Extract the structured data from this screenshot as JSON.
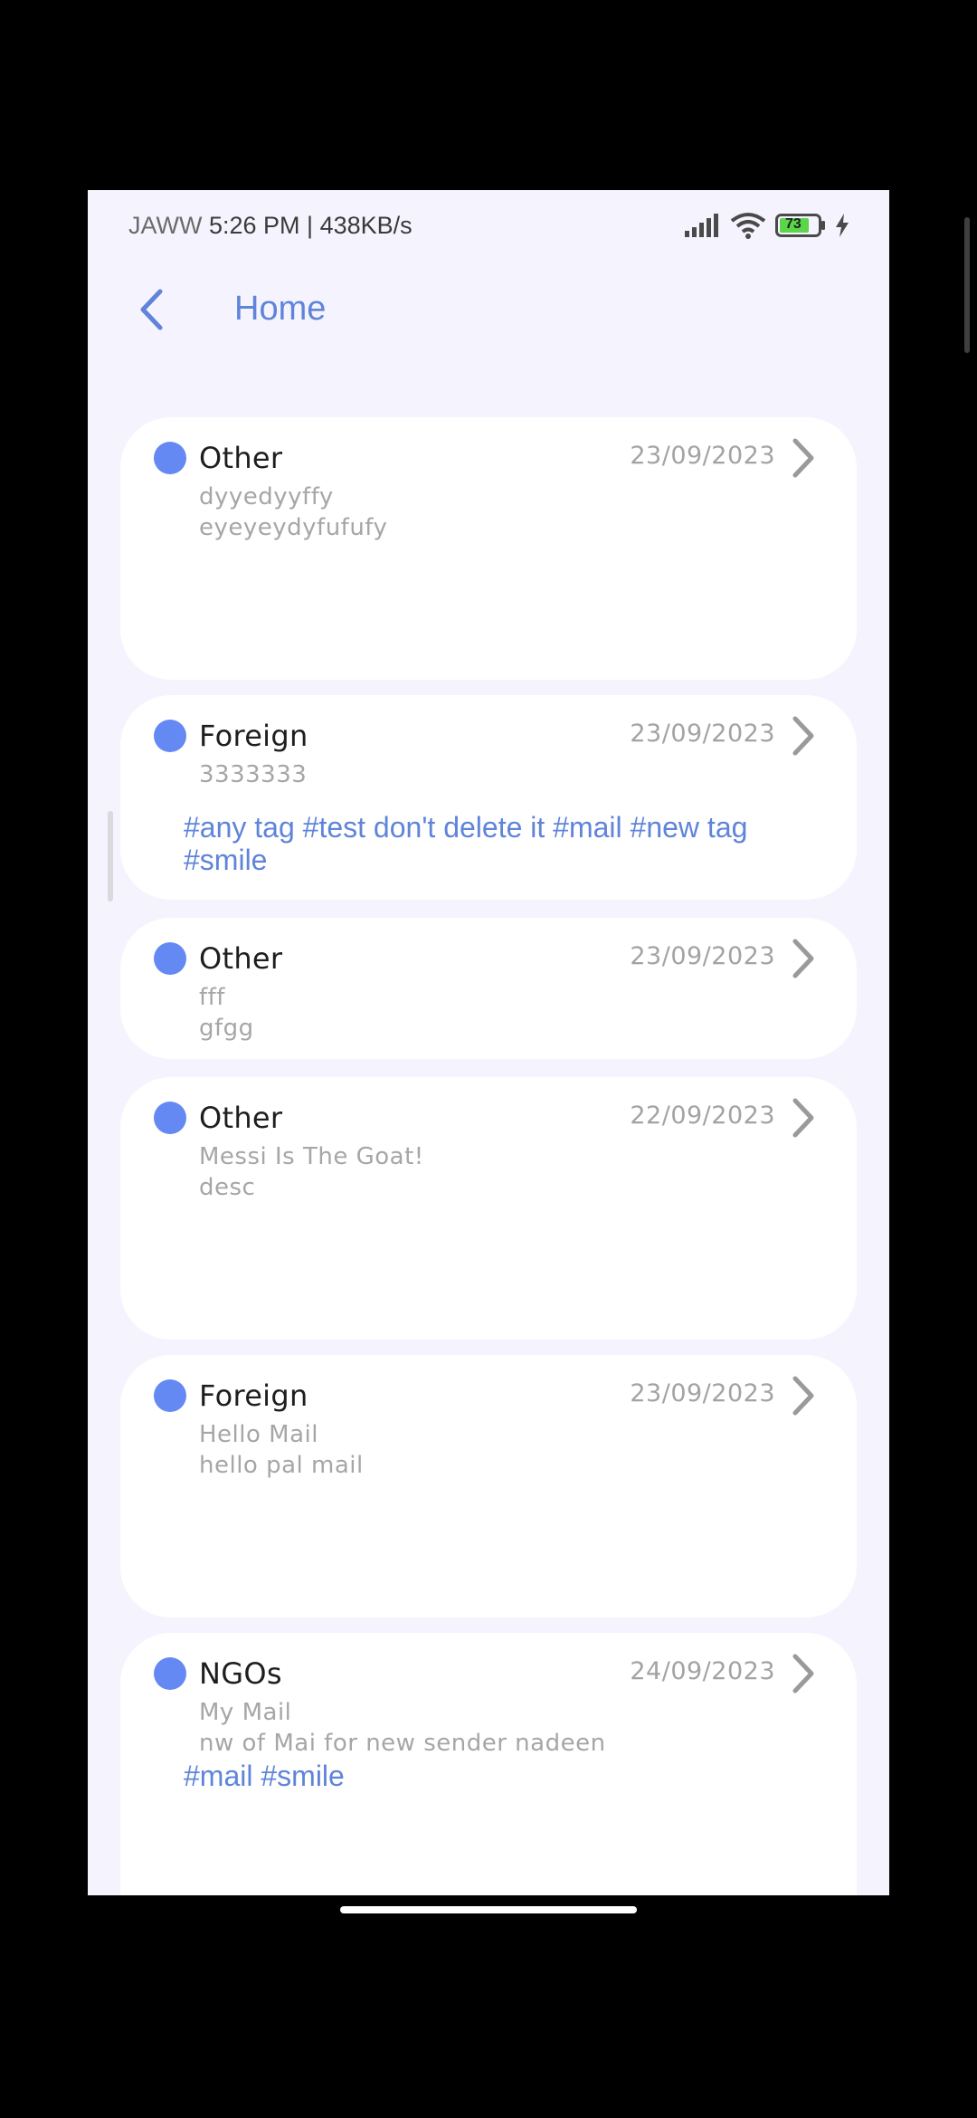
{
  "status_bar": {
    "carrier": "JAWW",
    "time_speed": "5:26 PM | 438KB/s",
    "battery": "73",
    "icons": [
      "signal-icon",
      "wifi-icon",
      "battery-icon",
      "charging-bolt-icon"
    ]
  },
  "app_bar": {
    "back_icon": "chevron-left-icon",
    "title": "Home"
  },
  "colors": {
    "background": "#f5f4fe",
    "accent": "#5f84d9",
    "dot": "#6489f2",
    "card": "#ffffff",
    "muted_text": "#a6a6a6"
  },
  "mails": [
    {
      "category": "Other",
      "date": "23/09/2023",
      "line1": "dyyedyyffy",
      "line2": "eyeyeydyfufufy",
      "tags": ""
    },
    {
      "category": "Foreign",
      "date": "23/09/2023",
      "line1": "3333333",
      "line2": "",
      "tags": "#any tag #test don't delete it #mail #new tag #smile"
    },
    {
      "category": "Other",
      "date": "23/09/2023",
      "line1": "fff",
      "line2": "gfgg",
      "tags": ""
    },
    {
      "category": "Other",
      "date": "22/09/2023",
      "line1": "Messi Is The Goat!",
      "line2": "desc",
      "tags": ""
    },
    {
      "category": "Foreign",
      "date": "23/09/2023",
      "line1": "Hello Mail",
      "line2": "hello pal mail",
      "tags": ""
    },
    {
      "category": "NGOs",
      "date": "24/09/2023",
      "line1": "My Mail",
      "line2": "nw of Mai for new sender nadeen",
      "tags": "#mail #smile"
    }
  ]
}
